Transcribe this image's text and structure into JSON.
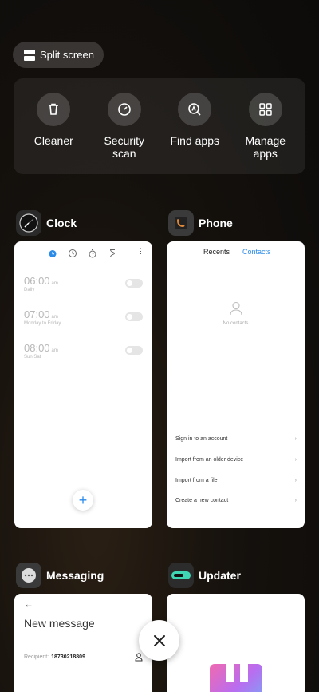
{
  "split_screen": {
    "label": "Split screen"
  },
  "quick_actions": [
    {
      "label": "Cleaner",
      "icon": "trash-icon"
    },
    {
      "label": "Security\nscan",
      "icon": "security-scan-icon"
    },
    {
      "label": "Find apps",
      "icon": "find-apps-icon"
    },
    {
      "label": "Manage\napps",
      "icon": "grid-icon"
    }
  ],
  "cards": {
    "clock": {
      "title": "Clock",
      "alarms": [
        {
          "time": "06:00",
          "ampm": "am",
          "repeat": "Daily"
        },
        {
          "time": "07:00",
          "ampm": "am",
          "repeat": "Monday to Friday"
        },
        {
          "time": "08:00",
          "ampm": "am",
          "repeat": "Sun Sat"
        }
      ],
      "add_label": "+"
    },
    "phone": {
      "title": "Phone",
      "tabs": [
        "Recents",
        "Contacts"
      ],
      "empty_text": "No contacts",
      "options": [
        "Sign in to an account",
        "Import from an older device",
        "Import from a file",
        "Create a new contact"
      ]
    },
    "messaging": {
      "title": "Messaging",
      "heading": "New message",
      "recipient_label": "Recipient:",
      "recipient_value": "18730218809"
    },
    "updater": {
      "title": "Updater"
    }
  },
  "colors": {
    "accent": "#2a8be9",
    "background": "#15110d"
  }
}
